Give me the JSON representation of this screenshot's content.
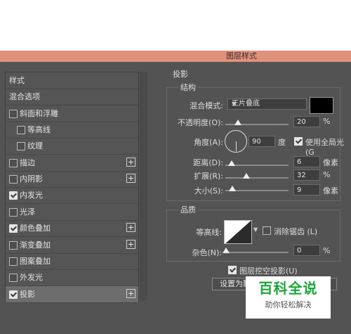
{
  "dialog": {
    "title": "图层样式"
  },
  "left_panel": {
    "items": [
      {
        "label": "样式",
        "checkbox": null,
        "plus": false,
        "selected": false
      },
      {
        "label": "混合选项",
        "checkbox": null,
        "plus": false,
        "selected": false
      },
      {
        "label": "斜面和浮雕",
        "checkbox": false,
        "plus": false,
        "selected": false
      },
      {
        "label": "等高线",
        "checkbox": false,
        "plus": false,
        "selected": false,
        "indent": true
      },
      {
        "label": "纹理",
        "checkbox": false,
        "plus": false,
        "selected": false,
        "indent": true
      },
      {
        "label": "描边",
        "checkbox": false,
        "plus": true,
        "selected": false
      },
      {
        "label": "内阴影",
        "checkbox": false,
        "plus": true,
        "selected": false
      },
      {
        "label": "内发光",
        "checkbox": true,
        "plus": false,
        "selected": false
      },
      {
        "label": "光泽",
        "checkbox": false,
        "plus": false,
        "selected": false
      },
      {
        "label": "颜色叠加",
        "checkbox": true,
        "plus": true,
        "selected": false
      },
      {
        "label": "渐变叠加",
        "checkbox": false,
        "plus": true,
        "selected": false
      },
      {
        "label": "图案叠加",
        "checkbox": false,
        "plus": false,
        "selected": false
      },
      {
        "label": "外发光",
        "checkbox": false,
        "plus": false,
        "selected": false
      },
      {
        "label": "投影",
        "checkbox": true,
        "plus": true,
        "selected": true
      }
    ]
  },
  "drop_shadow": {
    "section_title": "投影",
    "structure": {
      "title": "结构",
      "blend_mode_label": "混合模式:",
      "blend_mode_value": "正片叠底",
      "shadow_color": "#000000",
      "opacity_label": "不透明度(O):",
      "opacity_value": "20",
      "opacity_unit": "%",
      "opacity_level": 0.2,
      "angle_label": "角度(A):",
      "angle_value": "90",
      "angle_unit": "度",
      "global_light_label": "使用全局光(G",
      "global_light_checked": true,
      "distance_label": "距离(D):",
      "distance_value": "6",
      "distance_unit": "像素",
      "spread_label": "扩展(R):",
      "spread_value": "32",
      "spread_unit": "%",
      "size_label": "大小(S):",
      "size_value": "9",
      "size_unit": "像素"
    },
    "quality": {
      "title": "品质",
      "contour_label": "等高线:",
      "anti_alias_label": "消除锯齿 (L)",
      "anti_alias_checked": false,
      "noise_label": "杂色(N):",
      "noise_value": "0",
      "noise_unit": "%"
    },
    "knockout_label": "图层挖空投影(U)",
    "knockout_checked": true,
    "set_default_label": "设置为默"
  },
  "watermark": {
    "title": "百科全说",
    "subtitle": "助你轻松解决"
  }
}
